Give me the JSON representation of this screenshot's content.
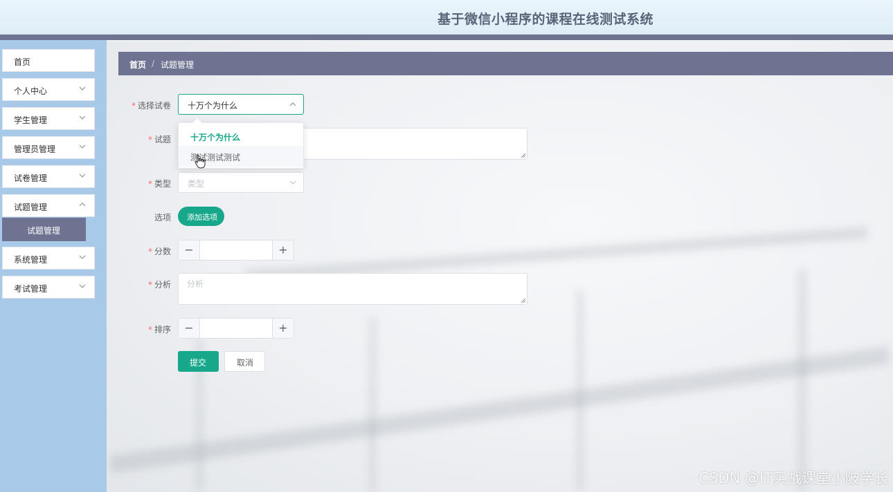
{
  "header": {
    "title": "基于微信小程序的课程在线测试系统"
  },
  "sidebar": {
    "items": [
      {
        "label": "首页"
      },
      {
        "label": "个人中心"
      },
      {
        "label": "学生管理"
      },
      {
        "label": "管理员管理"
      },
      {
        "label": "试卷管理"
      },
      {
        "label": "试题管理"
      },
      {
        "label": "系统管理"
      },
      {
        "label": "考试管理"
      }
    ],
    "active_sub": {
      "label": "试题管理"
    }
  },
  "breadcrumb": {
    "home": "首页",
    "separator": "/",
    "current": "试题管理"
  },
  "form": {
    "paper": {
      "label": "选择试卷",
      "value": "十万个为什么"
    },
    "question": {
      "label": "试题"
    },
    "type": {
      "label": "类型",
      "placeholder": "类型"
    },
    "options": {
      "label": "选项",
      "add_button": "添加选项"
    },
    "score": {
      "label": "分数",
      "minus": "−",
      "plus": "+"
    },
    "analysis": {
      "label": "分析",
      "placeholder": "分析"
    },
    "sort": {
      "label": "排序",
      "minus": "−",
      "plus": "+"
    },
    "submit": "提交",
    "cancel": "取消"
  },
  "dropdown": {
    "options": [
      {
        "label": "十万个为什么",
        "selected": true
      },
      {
        "label": "测试测试测试",
        "selected": false
      }
    ]
  },
  "watermark": "CSDN @IT实战课堂小陂学长",
  "colors": {
    "primary": "#17a88b",
    "nav": "#6e7391",
    "sidebar": "#a9c9e8"
  }
}
